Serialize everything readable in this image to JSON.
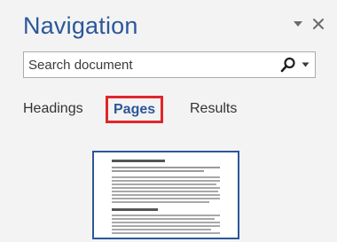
{
  "pane": {
    "title": "Navigation",
    "controls": {
      "menu_icon": "chevron-down-icon",
      "close_icon": "close-icon"
    }
  },
  "search": {
    "placeholder": "Search document",
    "icons": [
      "search-icon",
      "chevron-down-icon"
    ]
  },
  "tabs": [
    {
      "label": "Headings",
      "selected": false
    },
    {
      "label": "Pages",
      "selected": true,
      "highlighted": true
    },
    {
      "label": "Results",
      "selected": false
    }
  ],
  "colors": {
    "accent": "#2b579a",
    "highlight_box": "#e0262a",
    "pane_background": "#f3f3f3"
  }
}
